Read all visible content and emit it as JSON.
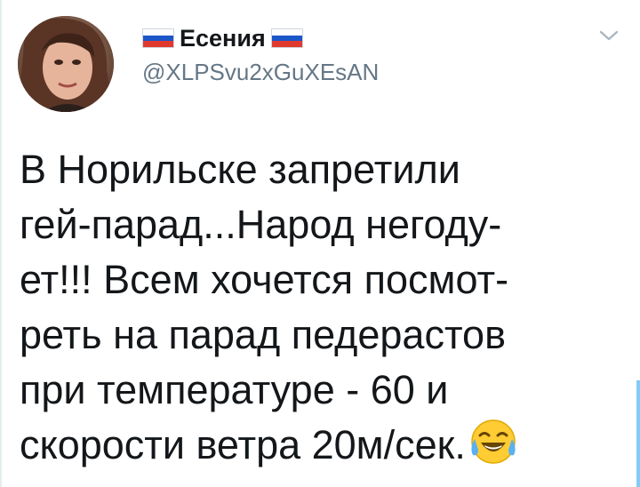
{
  "author": {
    "name": "Есения",
    "handle": "@XLPSvu2xGuXEsAN",
    "flag_colors": [
      "#ffffff",
      "#1c57c8",
      "#e03a2f"
    ]
  },
  "tweet": {
    "lines": [
      "В Норильске запретили",
      "гей-парад...Народ негоду-",
      "ет!!! Всем хочется посмот-",
      "реть на парад педерастов",
      "при температуре - 60 и",
      "скорости ветра 20м/сек."
    ],
    "emoji": "face-with-tears-of-joy"
  },
  "icons": {
    "menu": "chevron-down-icon",
    "avatar": "avatar"
  },
  "colors": {
    "text": "#14171a",
    "secondary": "#657786",
    "accent": "#1da1f2"
  }
}
